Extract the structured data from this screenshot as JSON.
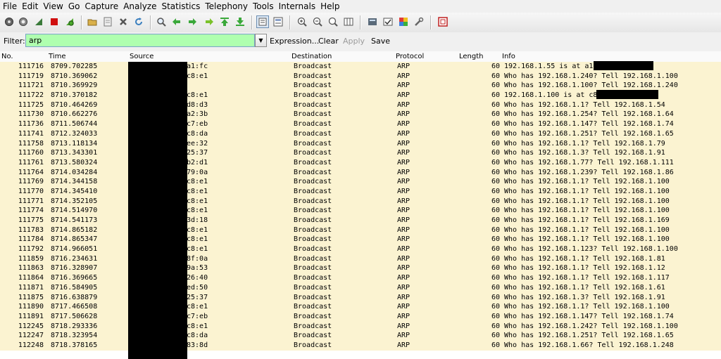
{
  "menu": [
    "File",
    "Edit",
    "View",
    "Go",
    "Capture",
    "Analyze",
    "Statistics",
    "Telephony",
    "Tools",
    "Internals",
    "Help"
  ],
  "toolbar_icons": [
    "interfaces-icon",
    "options-icon",
    "start-capture-icon",
    "stop-capture-icon",
    "restart-capture-icon",
    "open-file-icon",
    "save-file-icon",
    "close-file-icon",
    "reload-icon",
    "find-packet-icon",
    "go-back-icon",
    "go-forward-icon",
    "go-to-packet-icon",
    "go-first-icon",
    "go-last-icon",
    "colorize-icon",
    "auto-scroll-icon",
    "zoom-in-icon",
    "zoom-out-icon",
    "normal-size-icon",
    "resize-columns-icon",
    "capture-filters-icon",
    "display-filters-icon",
    "coloring-rules-icon",
    "preferences-icon",
    "help-icon"
  ],
  "filter": {
    "label": "Filter:",
    "value": "arp",
    "expression": "Expression...",
    "clear": "Clear",
    "apply": "Apply",
    "save": "Save",
    "background": "#afffaf"
  },
  "columns": {
    "no": "No.",
    "time": "Time",
    "source": "Source",
    "destination": "Destination",
    "protocol": "Protocol",
    "length": "Length",
    "info": "Info"
  },
  "row_color": "#fbf3d1",
  "rows": [
    {
      "no": "111716",
      "time": "8709.702285",
      "src": "a1:fc",
      "dst": "Broadcast",
      "proto": "ARP",
      "len": "60",
      "info": "192.168.1.55 is at             a1:fc"
    },
    {
      "no": "111719",
      "time": "8710.369062",
      "src": "c8:e1",
      "dst": "Broadcast",
      "proto": "ARP",
      "len": "60",
      "info": "Who has 192.168.1.240? Tell 192.168.1.100"
    },
    {
      "no": "111721",
      "time": "8710.369929",
      "src": "",
      "dst": "Broadcast",
      "proto": "ARP",
      "len": "60",
      "info": "Who has 192.168.1.100? Tell 192.168.1.240"
    },
    {
      "no": "111722",
      "time": "8710.370182",
      "src": "c8:e1",
      "dst": "Broadcast",
      "proto": "ARP",
      "len": "60",
      "info": "192.168.1.100 is at             c8:e1"
    },
    {
      "no": "111725",
      "time": "8710.464269",
      "src": "d8:d3",
      "dst": "Broadcast",
      "proto": "ARP",
      "len": "60",
      "info": "Who has 192.168.1.1? Tell 192.168.1.54"
    },
    {
      "no": "111730",
      "time": "8710.662276",
      "src": "a2:3b",
      "dst": "Broadcast",
      "proto": "ARP",
      "len": "60",
      "info": "Who has 192.168.1.254? Tell 192.168.1.64"
    },
    {
      "no": "111736",
      "time": "8711.506744",
      "src": "c7:eb",
      "dst": "Broadcast",
      "proto": "ARP",
      "len": "60",
      "info": "Who has 192.168.1.147? Tell 192.168.1.74"
    },
    {
      "no": "111741",
      "time": "8712.324033",
      "src": "c8:da",
      "dst": "Broadcast",
      "proto": "ARP",
      "len": "60",
      "info": "Who has 192.168.1.251? Tell 192.168.1.65"
    },
    {
      "no": "111758",
      "time": "8713.118134",
      "src": "ee:32",
      "dst": "Broadcast",
      "proto": "ARP",
      "len": "60",
      "info": "Who has 192.168.1.1? Tell 192.168.1.79"
    },
    {
      "no": "111760",
      "time": "8713.343301",
      "src": "25:37",
      "dst": "Broadcast",
      "proto": "ARP",
      "len": "60",
      "info": "Who has 192.168.1.3? Tell 192.168.1.91"
    },
    {
      "no": "111761",
      "time": "8713.580324",
      "src": "b2:d1",
      "dst": "Broadcast",
      "proto": "ARP",
      "len": "60",
      "info": "Who has 192.168.1.77? Tell 192.168.1.111"
    },
    {
      "no": "111764",
      "time": "8714.034284",
      "src": "79:0a",
      "dst": "Broadcast",
      "proto": "ARP",
      "len": "60",
      "info": "Who has 192.168.1.239? Tell 192.168.1.86"
    },
    {
      "no": "111769",
      "time": "8714.344158",
      "src": "c8:e1",
      "dst": "Broadcast",
      "proto": "ARP",
      "len": "60",
      "info": "Who has 192.168.1.1? Tell 192.168.1.100"
    },
    {
      "no": "111770",
      "time": "8714.345410",
      "src": "c8:e1",
      "dst": "Broadcast",
      "proto": "ARP",
      "len": "60",
      "info": "Who has 192.168.1.1? Tell 192.168.1.100"
    },
    {
      "no": "111771",
      "time": "8714.352105",
      "src": "c8:e1",
      "dst": "Broadcast",
      "proto": "ARP",
      "len": "60",
      "info": "Who has 192.168.1.1? Tell 192.168.1.100"
    },
    {
      "no": "111774",
      "time": "8714.514970",
      "src": "c8:e1",
      "dst": "Broadcast",
      "proto": "ARP",
      "len": "60",
      "info": "Who has 192.168.1.1? Tell 192.168.1.100"
    },
    {
      "no": "111775",
      "time": "8714.541173",
      "src": "3d:18",
      "dst": "Broadcast",
      "proto": "ARP",
      "len": "60",
      "info": "Who has 192.168.1.1? Tell 192.168.1.169"
    },
    {
      "no": "111783",
      "time": "8714.865182",
      "src": "c8:e1",
      "dst": "Broadcast",
      "proto": "ARP",
      "len": "60",
      "info": "Who has 192.168.1.1? Tell 192.168.1.100"
    },
    {
      "no": "111784",
      "time": "8714.865347",
      "src": "c8:e1",
      "dst": "Broadcast",
      "proto": "ARP",
      "len": "60",
      "info": "Who has 192.168.1.1? Tell 192.168.1.100"
    },
    {
      "no": "111792",
      "time": "8714.966051",
      "src": "c8:e1",
      "dst": "Broadcast",
      "proto": "ARP",
      "len": "60",
      "info": "Who has 192.168.1.123? Tell 192.168.1.100"
    },
    {
      "no": "111859",
      "time": "8716.234631",
      "src": "8f:0a",
      "dst": "Broadcast",
      "proto": "ARP",
      "len": "60",
      "info": "Who has 192.168.1.1? Tell 192.168.1.81"
    },
    {
      "no": "111863",
      "time": "8716.328907",
      "src": "9a:53",
      "dst": "Broadcast",
      "proto": "ARP",
      "len": "60",
      "info": "Who has 192.168.1.1? Tell 192.168.1.12"
    },
    {
      "no": "111864",
      "time": "8716.369665",
      "src": "26:40",
      "dst": "Broadcast",
      "proto": "ARP",
      "len": "60",
      "info": "Who has 192.168.1.1? Tell 192.168.1.117"
    },
    {
      "no": "111871",
      "time": "8716.584905",
      "src": "ed:50",
      "dst": "Broadcast",
      "proto": "ARP",
      "len": "60",
      "info": "Who has 192.168.1.1? Tell 192.168.1.61"
    },
    {
      "no": "111875",
      "time": "8716.638879",
      "src": "25:37",
      "dst": "Broadcast",
      "proto": "ARP",
      "len": "60",
      "info": "Who has 192.168.1.3? Tell 192.168.1.91"
    },
    {
      "no": "111890",
      "time": "8717.466508",
      "src": "c8:e1",
      "dst": "Broadcast",
      "proto": "ARP",
      "len": "60",
      "info": "Who has 192.168.1.1? Tell 192.168.1.100"
    },
    {
      "no": "111891",
      "time": "8717.506628",
      "src": "c7:eb",
      "dst": "Broadcast",
      "proto": "ARP",
      "len": "60",
      "info": "Who has 192.168.1.147? Tell 192.168.1.74"
    },
    {
      "no": "112245",
      "time": "8718.293336",
      "src": "c8:e1",
      "dst": "Broadcast",
      "proto": "ARP",
      "len": "60",
      "info": "Who has 192.168.1.242? Tell 192.168.1.100"
    },
    {
      "no": "112247",
      "time": "8718.323954",
      "src": "c8:da",
      "dst": "Broadcast",
      "proto": "ARP",
      "len": "60",
      "info": "Who has 192.168.1.251? Tell 192.168.1.65"
    },
    {
      "no": "112248",
      "time": "8718.378165",
      "src": "83:8d",
      "dst": "Broadcast",
      "proto": "ARP",
      "len": "60",
      "info": "Who has 192.168.1.66? Tell 192.168.1.248"
    }
  ]
}
